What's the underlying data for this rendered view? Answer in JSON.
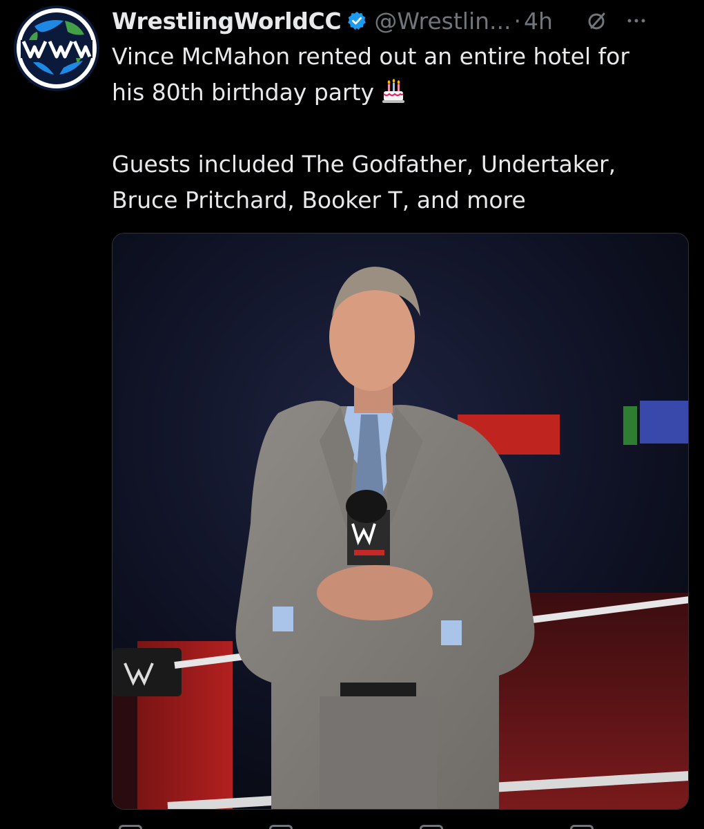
{
  "tweet": {
    "display_name": "WrestlingWorldCC",
    "handle": "@Wrestlin...",
    "separator": "·",
    "time": "4h",
    "text_line1": "Vince McMahon rented out an entire hotel for",
    "text_line2": "his 80th birthday party",
    "text_line3": "Guests included The Godfather, Undertaker,",
    "text_line4": "Bruce Pritchard, Booker T, and more"
  },
  "icons": {
    "avatar": "wrestlingworld-logo-icon",
    "verified": "verified-badge-icon",
    "grok": "grok-icon",
    "more": "more-options-icon",
    "cake": "birthday-cake-icon"
  },
  "colors": {
    "background": "#000000",
    "text": "#e7e9ea",
    "muted": "#71767b",
    "verified_blue": "#1d9bf0",
    "logo_blue": "#1565c0",
    "logo_green": "#2e9e3a"
  }
}
